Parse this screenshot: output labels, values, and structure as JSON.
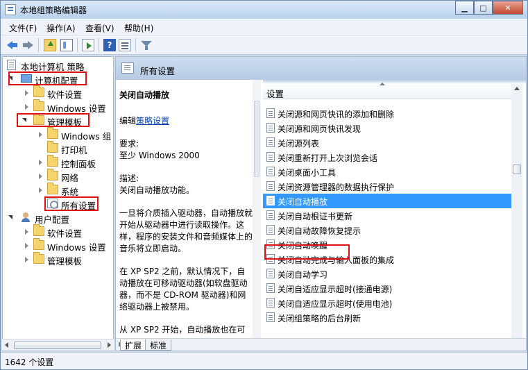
{
  "window": {
    "title": "本地组策略编辑器"
  },
  "menu": [
    "文件(F)",
    "操作(A)",
    "查看(V)",
    "帮助(H)"
  ],
  "tree": {
    "root": "本地计算机 策略",
    "computer_config": "计算机配置",
    "cc_software": "软件设置",
    "cc_windows": "Windows 设置",
    "cc_admin": "管理模板",
    "admin_windows": "Windows 组",
    "admin_printers": "打印机",
    "admin_control": "控制面板",
    "admin_network": "网络",
    "admin_system": "系统",
    "admin_all": "所有设置",
    "user_config": "用户配置",
    "uc_software": "软件设置",
    "uc_windows": "Windows 设置",
    "uc_admin": "管理模板"
  },
  "right_header": {
    "title": "所有设置"
  },
  "description": {
    "title": "关闭自动播放",
    "edit_prefix": "编辑",
    "edit_link": "策略设置",
    "requirements_label": "要求:",
    "requirements_value": "至少 Windows 2000",
    "desc_label": "描述:",
    "desc_value": "关闭自动播放功能。",
    "para1": "一旦将介质插入驱动器，自动播放就开始从驱动器中进行读取操作。这样，程序的安装文件和音频媒体上的音乐将立即启动。",
    "para2": "在 XP SP2 之前，默认情况下，自动播放在可移动驱动器(如软盘驱动器，而不是 CD-ROM 驱动器)和网络驱动器上被禁用。",
    "para3": "从 XP SP2 开始，自动播放也在可"
  },
  "list": {
    "column_header": "设置",
    "items": [
      "关闭源和网页快讯的添加和删除",
      "关闭源和网页快讯发现",
      "关闭源列表",
      "关闭重新打开上次浏览会话",
      "关闭桌面小工具",
      "关闭资源管理器的数据执行保护",
      "关闭自动播放",
      "关闭自动根证书更新",
      "关闭自动故障恢复提示",
      "关闭自动唤醒",
      "关闭自动完成与输入面板的集成",
      "关闭自动学习",
      "关闭自适应显示超时(接通电源)",
      "关闭自适应显示超时(使用电池)",
      "关闭组策略的后台刷新"
    ],
    "selected_index": 6
  },
  "tabs": [
    "扩展",
    "标准"
  ],
  "status": {
    "count_text": "1642 个设置"
  },
  "colors": {
    "selection": "#3399ff",
    "highlight_box": "#e01010"
  }
}
